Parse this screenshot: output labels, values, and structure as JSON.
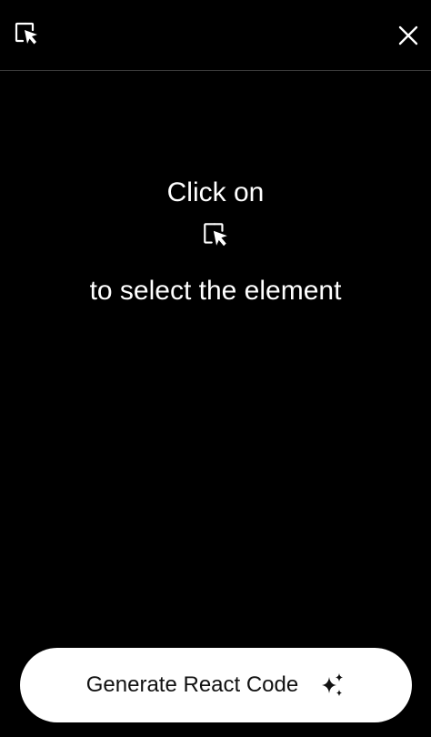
{
  "header": {
    "select_icon": "select-element-icon",
    "close_icon": "close-icon"
  },
  "instructions": {
    "line1": "Click on",
    "inline_icon": "select-element-icon",
    "line2": "to select the element"
  },
  "footer": {
    "generate_label": "Generate React Code",
    "generate_icon": "sparkles-icon"
  },
  "colors": {
    "background": "#000000",
    "text": "#ffffff",
    "button_bg": "#ffffff",
    "button_text": "#111111",
    "divider": "#3a3a3a"
  }
}
